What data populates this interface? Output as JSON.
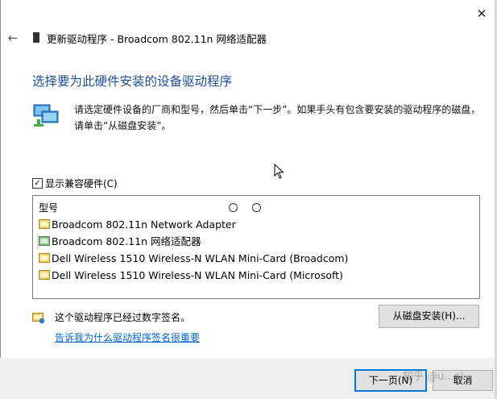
{
  "window": {
    "title": "更新驱动程序 - Broadcom 802.11n 网络适配器",
    "close_glyph": "✕",
    "back_glyph": "←"
  },
  "heading": "选择要为此硬件安装的设备驱动程序",
  "description": "请选定硬件设备的厂商和型号，然后单击“下一步”。如果手头有包含要安装的驱动程序的磁盘，请单击“从磁盘安装”。",
  "compatible_checkbox": {
    "label": "显示兼容硬件(C)",
    "checked": true,
    "check_glyph": "✓"
  },
  "model_list": {
    "header": "型号",
    "items": [
      {
        "label": "Broadcom 802.11n Network Adapter",
        "selected": false
      },
      {
        "label": "Broadcom 802.11n 网络适配器",
        "selected": true
      },
      {
        "label": "Dell Wireless 1510 Wireless-N WLAN Mini-Card (Broadcom)",
        "selected": false
      },
      {
        "label": "Dell Wireless 1510 Wireless-N WLAN Mini-Card (Microsoft)",
        "selected": false
      }
    ]
  },
  "signature": {
    "text": "这个驱动程序已经过数字签名。",
    "link": "告诉我为什么驱动程序签名很重要"
  },
  "buttons": {
    "have_disk": "从磁盘安装(H)...",
    "next": "下一页(N)",
    "cancel": "取消"
  },
  "watermark": "知乎 @u...ol",
  "colors": {
    "heading": "#1e4f9c",
    "link": "#0066cc",
    "accent_border": "#0078d7",
    "footer_bg": "#f0f0f0"
  }
}
